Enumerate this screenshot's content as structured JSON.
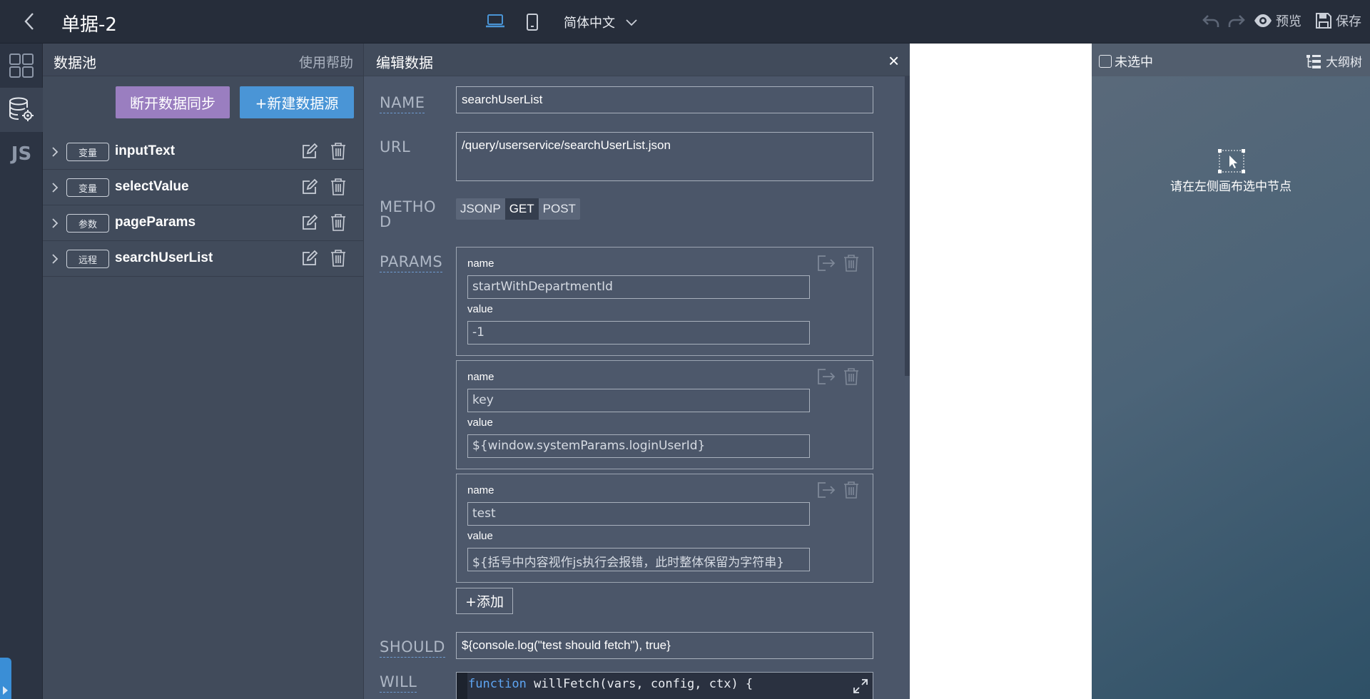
{
  "header": {
    "title": "单据-2",
    "language": "简体中文",
    "preview_label": "预览",
    "save_label": "保存"
  },
  "pool": {
    "title": "数据池",
    "help": "使用帮助",
    "disconnect_label": "断开数据同步",
    "new_label": "+新建数据源",
    "items": [
      {
        "tag": "变量",
        "name": "inputText"
      },
      {
        "tag": "变量",
        "name": "selectValue"
      },
      {
        "tag": "参数",
        "name": "pageParams"
      },
      {
        "tag": "远程",
        "name": "searchUserList"
      }
    ]
  },
  "editor": {
    "title": "编辑数据",
    "close": "×",
    "labels": {
      "name": "NAME",
      "url": "URL",
      "method_line1": "METHO",
      "method_line2": "D",
      "params": "PARAMS",
      "should": "SHOULD",
      "will": "WILL"
    },
    "name_value": "searchUserList",
    "url_value": "/query/userservice/searchUserList.json",
    "methods": [
      "JSONP",
      "GET",
      "POST"
    ],
    "method_selected": "GET",
    "params": [
      {
        "name_label": "name",
        "name_value": "startWithDepartmentId",
        "value_label": "value",
        "value_value": "-1"
      },
      {
        "name_label": "name",
        "name_value": "key",
        "value_label": "value",
        "value_value": "${window.systemParams.loginUserId}"
      },
      {
        "name_label": "name",
        "name_value": "test",
        "value_label": "value",
        "value_value": "${括号中内容视作js执行会报错，此时整体保留为字符串}"
      }
    ],
    "add_label": "+添加",
    "should_value": "${console.log(\"test should fetch\"), true}",
    "will_code_kw": "function",
    "will_code_rest": " willFetch(vars, config, ctx) {"
  },
  "canvas": {
    "unselected_label": "未选中",
    "outline_label": "大纲树",
    "placeholder": "请在左侧画布选中节点"
  },
  "colors": {
    "accent_blue": "#4a95d6",
    "accent_purple": "#9a7ec0",
    "topbar": "#262d3a"
  }
}
